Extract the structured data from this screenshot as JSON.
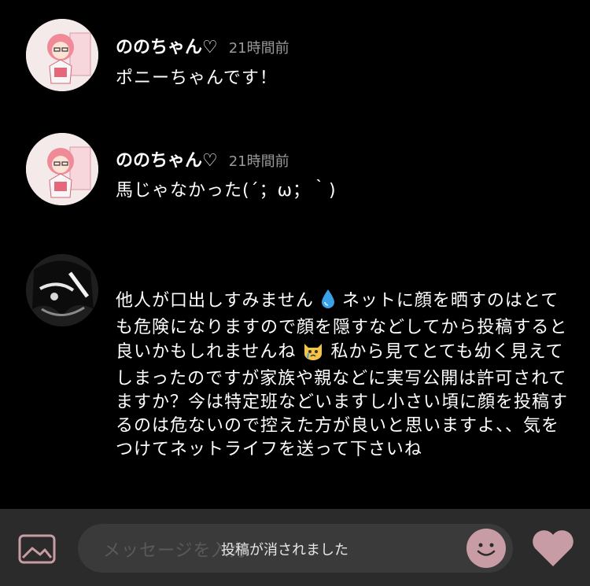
{
  "comments": [
    {
      "user": "ののちゃん♡",
      "time": "21時間前",
      "text": "ポニーちゃんです！"
    },
    {
      "user": "ののちゃん♡",
      "time": "21時間前",
      "text": "馬じゃなかった(´；ω；｀)"
    },
    {
      "user": "",
      "text_parts": [
        "他人が口出しすみません",
        "ネットに顔を晒すのはとても危険になりますので顔を隠すなどしてから投稿すると良いかもしれませんね",
        "私から見てとても幼く見えてしまったのですが家族や親などに実写公開は許可されてますか？今は特定班などいますし小さい頃に顔を投稿するのは危ないので控えた方が良いと思いますよ、、気をつけてネットライフを送って下さいね"
      ]
    }
  ],
  "input": {
    "placeholder": "メッセージを入力",
    "toast": "投稿が消されました"
  },
  "icons": {
    "media": "image-icon",
    "emoji": "smiley-icon",
    "like": "heart-icon",
    "drop": "water-drop-emoji",
    "cry": "crying-cat-emoji"
  },
  "colors": {
    "accent": "#c79ca5",
    "background": "#000000",
    "bar": "#2b2b2b"
  }
}
